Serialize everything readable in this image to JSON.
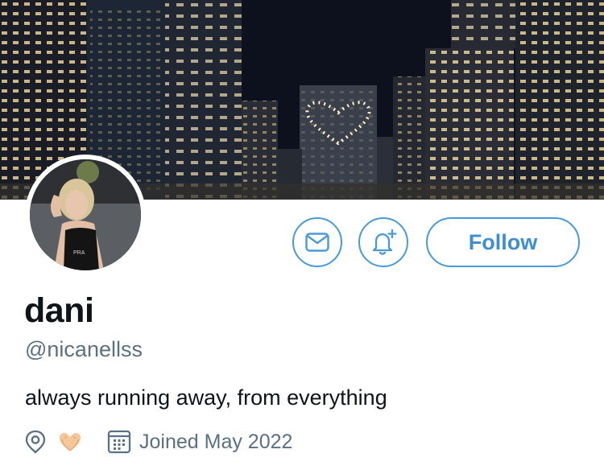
{
  "banner": {
    "icon": "city-night-heart-banner"
  },
  "avatar": {
    "icon": "profile-photo"
  },
  "actions": {
    "message_icon": "envelope-icon",
    "notify_icon": "bell-plus-icon",
    "follow_label": "Follow"
  },
  "profile": {
    "display_name": "dani",
    "handle": "@nicanellss",
    "bio": "always running away, from everything",
    "location_icon": "location-pin-icon",
    "location_emoji": "heart-hands-emoji",
    "calendar_icon": "calendar-icon",
    "joined": "Joined May 2022"
  },
  "colors": {
    "accent": "#4a9ad9",
    "text": "#0f1419",
    "muted": "#5b7083"
  }
}
